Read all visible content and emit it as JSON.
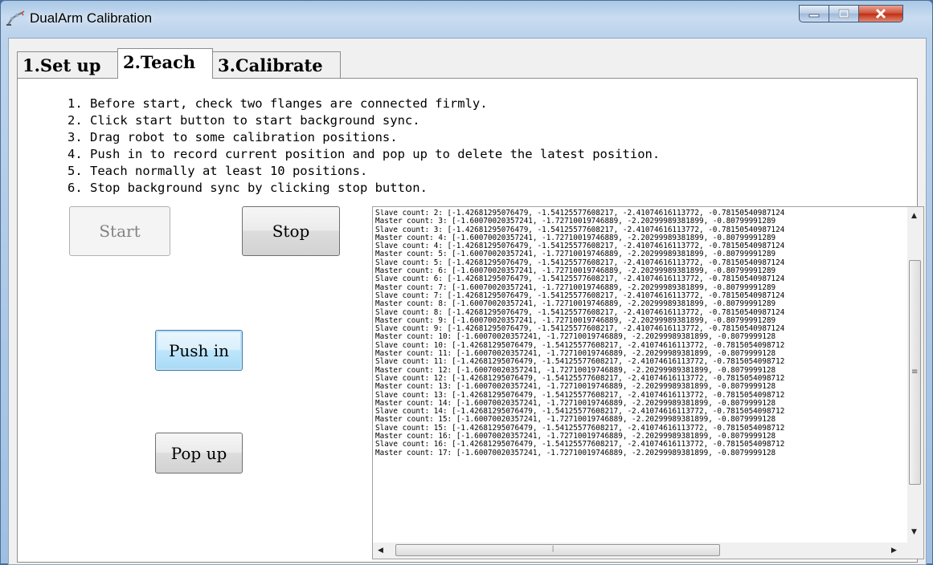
{
  "window": {
    "title": "DualArm Calibration"
  },
  "tabs": [
    {
      "label": "1.Set up",
      "active": false
    },
    {
      "label": "2.Teach",
      "active": true
    },
    {
      "label": "3.Calibrate",
      "active": false
    }
  ],
  "instructions": [
    "1. Before start, check two flanges are connected firmly.",
    "2. Click start button to start background sync.",
    "3. Drag robot to some calibration positions.",
    "4. Push in to record current position and pop up to delete the latest position.",
    "5. Teach normally at least 10 positions.",
    "6. Stop background sync by clicking stop button."
  ],
  "buttons": {
    "start": "Start",
    "stop": "Stop",
    "push_in": "Push in",
    "pop_up": "Pop up"
  },
  "log": {
    "lines": [
      "Slave count: 2: [-1.42681295076479, -1.54125577608217, -2.41074616113772, -0.78150540987124",
      "Master count: 3: [-1.60070020357241, -1.72710019746889, -2.20299989381899, -0.80799991289",
      "Slave count: 3: [-1.42681295076479, -1.54125577608217, -2.41074616113772, -0.78150540987124",
      "Master count: 4: [-1.60070020357241, -1.72710019746889, -2.20299989381899, -0.80799991289",
      "Slave count: 4: [-1.42681295076479, -1.54125577608217, -2.41074616113772, -0.78150540987124",
      "Master count: 5: [-1.60070020357241, -1.72710019746889, -2.20299989381899, -0.80799991289",
      "Slave count: 5: [-1.42681295076479, -1.54125577608217, -2.41074616113772, -0.78150540987124",
      "Master count: 6: [-1.60070020357241, -1.72710019746889, -2.20299989381899, -0.80799991289",
      "Slave count: 6: [-1.42681295076479, -1.54125577608217, -2.41074616113772, -0.78150540987124",
      "Master count: 7: [-1.60070020357241, -1.72710019746889, -2.20299989381899, -0.80799991289",
      "Slave count: 7: [-1.42681295076479, -1.54125577608217, -2.41074616113772, -0.78150540987124",
      "Master count: 8: [-1.60070020357241, -1.72710019746889, -2.20299989381899, -0.80799991289",
      "Slave count: 8: [-1.42681295076479, -1.54125577608217, -2.41074616113772, -0.78150540987124",
      "Master count: 9: [-1.60070020357241, -1.72710019746889, -2.20299989381899, -0.80799991289",
      "Slave count: 9: [-1.42681295076479, -1.54125577608217, -2.41074616113772, -0.78150540987124",
      "Master count: 10: [-1.60070020357241, -1.72710019746889, -2.20299989381899, -0.8079999128",
      "Slave count: 10: [-1.42681295076479, -1.54125577608217, -2.41074616113772, -0.7815054098712",
      "Master count: 11: [-1.60070020357241, -1.72710019746889, -2.20299989381899, -0.8079999128",
      "Slave count: 11: [-1.42681295076479, -1.54125577608217, -2.41074616113772, -0.7815054098712",
      "Master count: 12: [-1.60070020357241, -1.72710019746889, -2.20299989381899, -0.8079999128",
      "Slave count: 12: [-1.42681295076479, -1.54125577608217, -2.41074616113772, -0.7815054098712",
      "Master count: 13: [-1.60070020357241, -1.72710019746889, -2.20299989381899, -0.8079999128",
      "Slave count: 13: [-1.42681295076479, -1.54125577608217, -2.41074616113772, -0.7815054098712",
      "Master count: 14: [-1.60070020357241, -1.72710019746889, -2.20299989381899, -0.8079999128",
      "Slave count: 14: [-1.42681295076479, -1.54125577608217, -2.41074616113772, -0.7815054098712",
      "Master count: 15: [-1.60070020357241, -1.72710019746889, -2.20299989381899, -0.8079999128",
      "Slave count: 15: [-1.42681295076479, -1.54125577608217, -2.41074616113772, -0.7815054098712",
      "Master count: 16: [-1.60070020357241, -1.72710019746889, -2.20299989381899, -0.8079999128",
      "Slave count: 16: [-1.42681295076479, -1.54125577608217, -2.41074616113772, -0.7815054098712",
      "Master count: 17: [-1.60070020357241, -1.72710019746889, -2.20299989381899, -0.8079999128"
    ]
  },
  "colors": {
    "close_button": "#c7361d",
    "focus_border": "#3c7fb1"
  }
}
